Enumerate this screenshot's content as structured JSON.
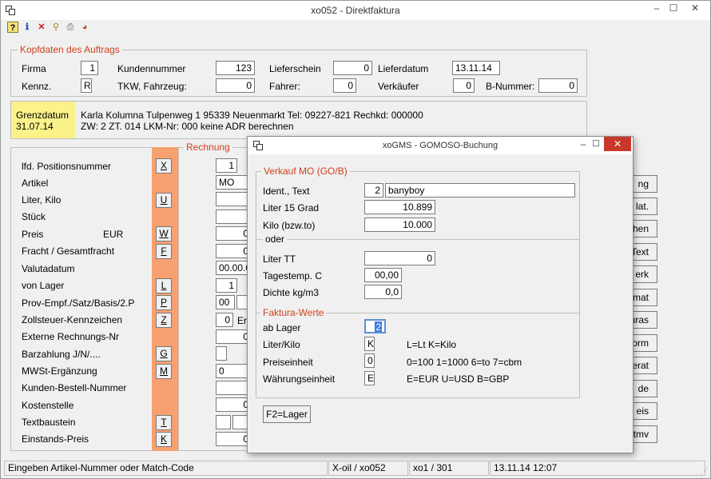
{
  "window": {
    "title": "xo052 - Direktfaktura",
    "minimize": "–",
    "maximize": "☐",
    "close": "✕"
  },
  "toolbar": {
    "icons": [
      "help-icon",
      "info-icon",
      "delete-icon",
      "search-icon",
      "print-icon",
      "color-icon"
    ]
  },
  "header_group": {
    "legend": "Kopfdaten des Auftrags",
    "firma_label": "Firma",
    "firma_value": "1",
    "kundennummer_label": "Kundennummer",
    "kundennummer_value": "123",
    "lieferschein_label": "Lieferschein",
    "lieferschein_value": "0",
    "lieferdatum_label": "Lieferdatum",
    "lieferdatum_value": "13.11.14",
    "kennz_label": "Kennz.",
    "kennz_value": "R",
    "tkw_label": "TKW, Fahrzeug:",
    "tkw_value": "0",
    "fahrer_label": "Fahrer:",
    "fahrer_value": "0",
    "verkaeufer_label": "Verkäufer",
    "verkaeufer_value": "0",
    "bnummer_label": "B-Nummer:",
    "bnummer_value": "0"
  },
  "grenz": {
    "label": "Grenzdatum",
    "date": "31.07.14",
    "line1": "Karla Kolumna Tulpenweg 1 95339 Neuenmarkt Tel: 09227-821 Rechkd: 000000",
    "line2": "ZW: 2 ZT. 014 LKM-Nr: 000 keine ADR berechnen"
  },
  "left_labels": {
    "pos": "lfd. Positionsnummer",
    "artikel": "Artikel",
    "liter": "Liter, Kilo",
    "stueck": "Stück",
    "preis": "Preis",
    "preis_eur": "EUR",
    "fracht": "Fracht  /  Gesamtfracht",
    "valuta": "Valutadatum",
    "lager": "von Lager",
    "prov": "Prov-Empf./Satz/Basis/2.P",
    "zoll": "Zollsteuer-Kennzeichen",
    "extern": "Externe Rechnungs-Nr",
    "barzahlung": "Barzahlung J/N/....",
    "mwst": "MWSt-Ergänzung",
    "kunden": "Kunden-Bestell-Nummer",
    "kosten": "Kostenstelle",
    "text": "Textbaustein",
    "einstand": "Einstands-Preis"
  },
  "keys": {
    "x": "X",
    "u": "U",
    "w": "W",
    "f": "F",
    "l": "L",
    "p": "P",
    "z": "Z",
    "g": "G",
    "m": "M",
    "t": "T",
    "k": "K"
  },
  "rechnung": {
    "legend": "Rechnung",
    "pos": "1",
    "artikel": "MO",
    "preis": "0",
    "fracht": "0",
    "valuta": "00.00.0",
    "lager": "1",
    "prov": "00",
    "zoll": "0",
    "zoll_text": "Er",
    "extern": "0",
    "mwst": "0",
    "kunden": "",
    "kosten": "0",
    "einstand": "0"
  },
  "side_buttons": [
    "ng",
    "lat.",
    "hen",
    "Text",
    "erk",
    "mat",
    "uras",
    "orm",
    "erat",
    "de",
    "eis",
    "tmv"
  ],
  "dialog": {
    "title": "xoGMS - GOMOSO-Buchung",
    "minimize": "–",
    "maximize": "☐",
    "close": "✕",
    "verkauf_legend": "Verkauf MO (GO/B)",
    "ident_label": "Ident., Text",
    "ident_value": "2",
    "ident_text": "banyboy",
    "liter15_label": "Liter 15 Grad",
    "liter15_value": "10.899",
    "kilo_label": "Kilo (bzw.to)",
    "kilo_value": "10.000",
    "oder_label": "oder",
    "litertt_label": "Liter TT",
    "litertt_value": "0",
    "tagestemp_label": "Tagestemp. C",
    "tagestemp_value": "00,00",
    "dichte_label": "Dichte kg/m3",
    "dichte_value": "0,0",
    "faktura_legend": "Faktura-Werte",
    "ablager_label": "ab Lager",
    "ablager_value": "2",
    "literkilo_label": "Liter/Kilo",
    "literkilo_value": "K",
    "literkilo_hint": "L=Lt  K=Kilo",
    "preiseinheit_label": "Preiseinheit",
    "preiseinheit_value": "0",
    "preiseinheit_hint": "0=100 1=1000 6=to 7=cbm",
    "waehrung_label": "Währungseinheit",
    "waehrung_value": "E",
    "waehrung_hint": "E=EUR U=USD B=GBP",
    "f2_button": "F2=Lager"
  },
  "statusbar": {
    "message": "Eingeben Artikel-Nummer oder Match-Code",
    "module": "X-oil / xo052",
    "user": "xo1 / 301",
    "datetime": "13.11.14 12:07"
  }
}
